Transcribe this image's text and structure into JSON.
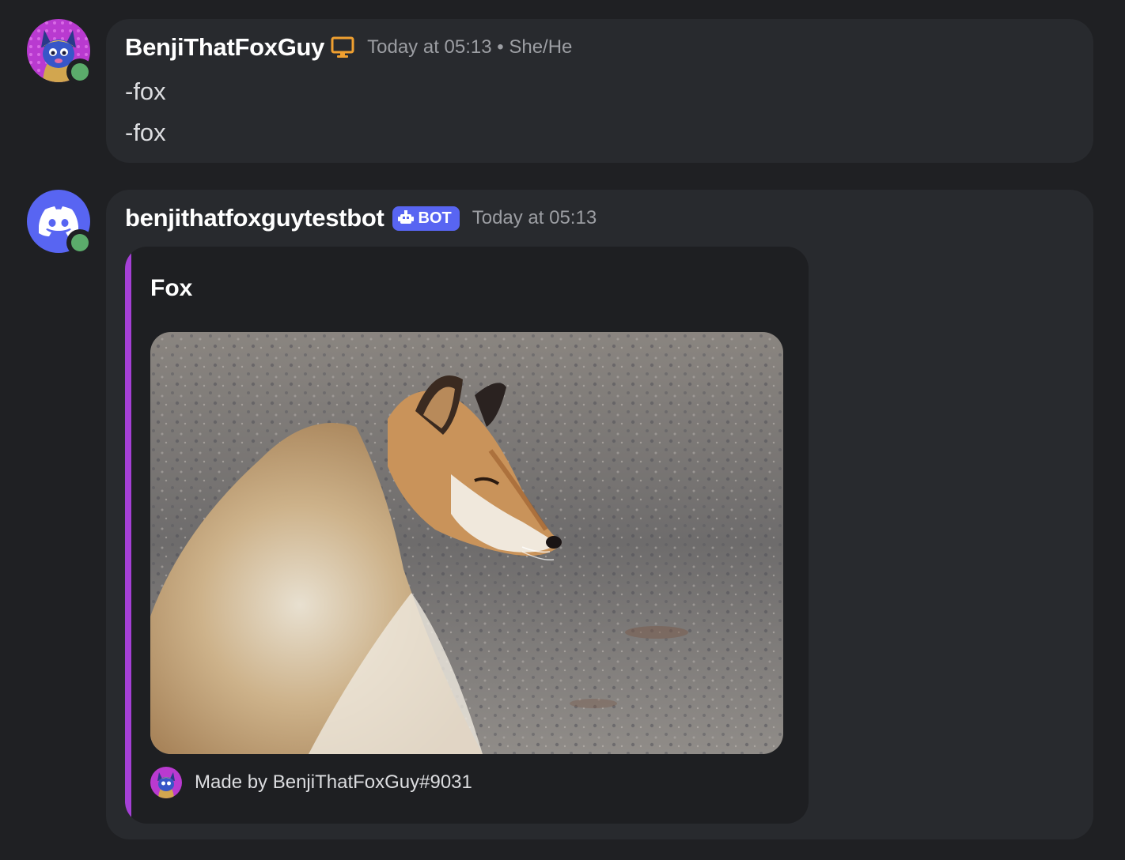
{
  "messages": [
    {
      "username": "BenjiThatFoxGuy",
      "device_icon": "desktop-icon",
      "timestamp": "Today at 05:13 • She/He",
      "lines": [
        "-fox",
        "-fox"
      ],
      "status": "online"
    },
    {
      "username": "benjithatfoxguytestbot",
      "badge": "BOT",
      "timestamp": "Today at 05:13",
      "status": "online",
      "embed": {
        "title": "Fox",
        "accent_color": "#a540d6",
        "image_alt": "fox-photo",
        "footer_text": "Made by BenjiThatFoxGuy#9031"
      }
    }
  ],
  "colors": {
    "background": "#1f2023",
    "bubble": "#282a2e",
    "online": "#5bab6b",
    "bot_badge": "#5865f2",
    "device_icon": "#f0a030"
  }
}
